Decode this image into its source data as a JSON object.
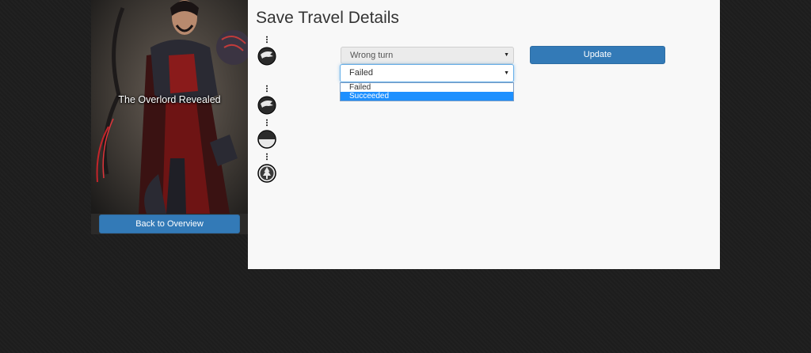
{
  "card": {
    "title": "The Overlord Revealed",
    "back_label": "Back to Overview"
  },
  "main": {
    "title": "Save Travel Details"
  },
  "timeline": [
    {
      "icon": "dragon-head-icon"
    },
    {
      "icon": "dragon-head-icon"
    },
    {
      "icon": "half-circle-icon"
    },
    {
      "icon": "tree-icon"
    }
  ],
  "form": {
    "event_value": "Wrong turn",
    "status_value": "Failed",
    "status_options": [
      "Failed",
      "Succeeded"
    ],
    "highlighted_option": "Succeeded",
    "update_label": "Update"
  },
  "colors": {
    "background": "#1e1e1e",
    "panel": "#f8f8f8",
    "primary_button": "#337ab7",
    "dropdown_highlight": "#1e90ff"
  }
}
